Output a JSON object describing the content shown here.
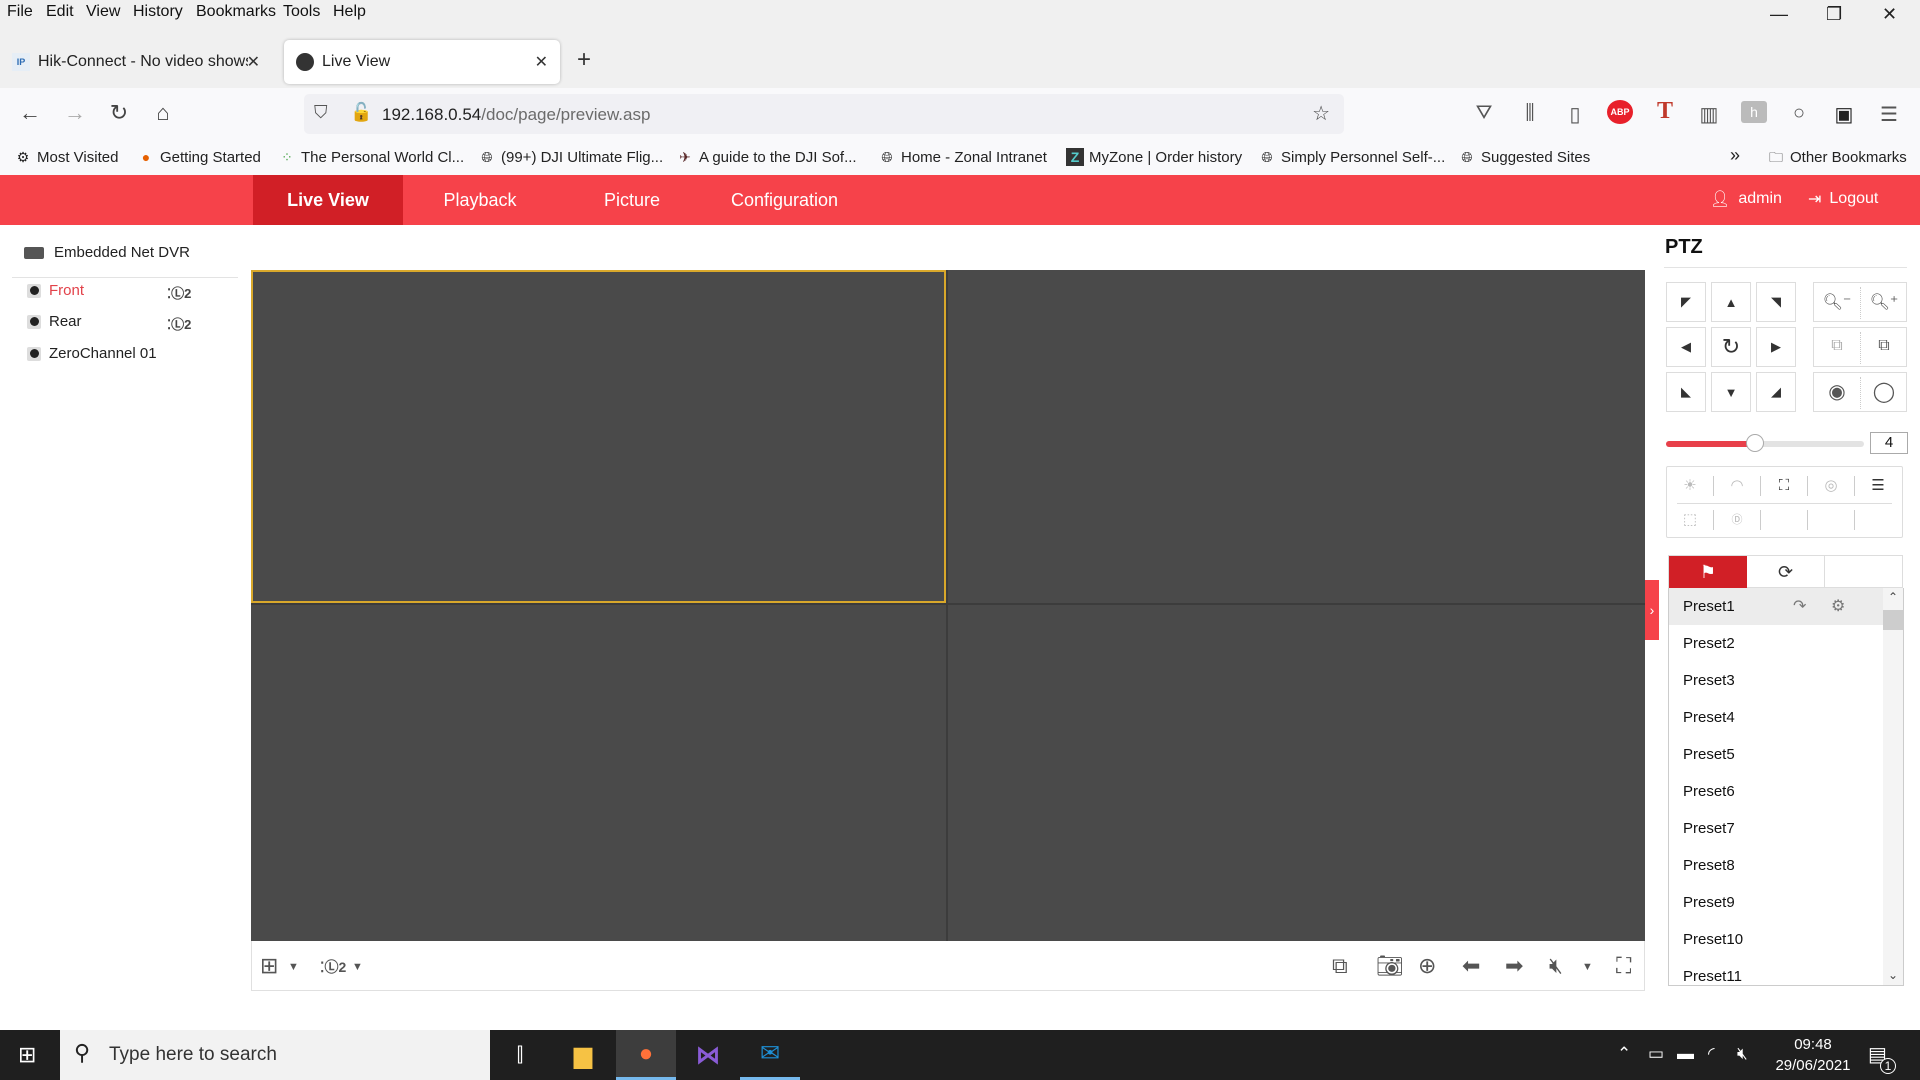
{
  "browser": {
    "menu": [
      "File",
      "Edit",
      "View",
      "History",
      "Bookmarks",
      "Tools",
      "Help"
    ],
    "window_controls": {
      "minimize_icon": "minimize-icon",
      "restore_icon": "restore-icon",
      "close_icon": "close-icon"
    },
    "tabs": [
      {
        "title": "Hik-Connect - No video shows i",
        "favicon": "use-ip-icon",
        "active": false
      },
      {
        "title": "Live View",
        "favicon": "camera-icon",
        "active": true
      }
    ],
    "new_tab": "+",
    "url": {
      "host": "192.168.0.54",
      "path": "/doc/page/preview.asp"
    },
    "toolbar_icons": [
      "pocket-icon",
      "library-icon",
      "sidebar-icon",
      "adblock-plus-icon",
      "t-extension-icon",
      "grid-extension-icon",
      "honey-extension-icon",
      "circle-extension-icon",
      "download-extension-icon",
      "menu-icon"
    ],
    "bookmarks": [
      {
        "label": "Most Visited",
        "icon": "gear-icon"
      },
      {
        "label": "Getting Started",
        "icon": "firefox-icon"
      },
      {
        "label": "The Personal World Cl...",
        "icon": "dots-icon"
      },
      {
        "label": "(99+) DJI Ultimate Flig...",
        "icon": "globe-icon"
      },
      {
        "label": "A guide to the DJI Sof...",
        "icon": "bird-icon"
      },
      {
        "label": "Home - Zonal Intranet",
        "icon": "globe-icon"
      },
      {
        "label": "MyZone | Order history",
        "icon": "z-icon"
      },
      {
        "label": "Simply Personnel Self-...",
        "icon": "globe-icon"
      },
      {
        "label": "Suggested Sites",
        "icon": "globe-icon"
      }
    ],
    "bookmarks_overflow": "»",
    "other_bookmarks": "Other Bookmarks"
  },
  "app": {
    "nav": [
      {
        "label": "Live View",
        "active": true
      },
      {
        "label": "Playback",
        "active": false
      },
      {
        "label": "Picture",
        "active": false
      },
      {
        "label": "Configuration",
        "active": false
      }
    ],
    "user": "admin",
    "logout": "Logout",
    "accent": "#f6424a",
    "accent_dark": "#d11f26"
  },
  "tree": {
    "root": "Embedded Net DVR",
    "channels": [
      {
        "name": "Front",
        "selected": true,
        "stream_icon": true
      },
      {
        "name": "Rear",
        "selected": false,
        "stream_icon": true
      },
      {
        "name": "ZeroChannel 01",
        "selected": false,
        "stream_icon": false
      }
    ]
  },
  "video": {
    "layout": "2x2",
    "selected_cell": 1,
    "toolbar_left": [
      "window-layout-icon",
      "stream-type-icon"
    ],
    "toolbar_right": [
      "stop-all-icon",
      "capture-icon",
      "digital-zoom-icon",
      "previous-page-icon",
      "next-page-icon",
      "audio-muted-icon",
      "fullscreen-icon"
    ]
  },
  "ptz": {
    "title": "PTZ",
    "speed": "4",
    "speed_fraction": 0.45,
    "direction_buttons": [
      "up-left",
      "up",
      "up-right",
      "left",
      "auto-rotate",
      "right",
      "down-left",
      "down",
      "down-right"
    ],
    "groups": [
      [
        "zoom-out-icon",
        "zoom-in-icon"
      ],
      [
        "focus-near-icon",
        "focus-far-icon"
      ],
      [
        "iris-open-icon",
        "iris-close-icon"
      ]
    ],
    "functions_row1": [
      "light-icon",
      "wiper-icon",
      "one-touch-focus-icon",
      "lens-init-icon",
      "menu-icon"
    ],
    "functions_row2": [
      "manual-tracking-icon",
      "3d-positioning-icon"
    ],
    "tabs": [
      "preset-icon",
      "patrol-icon",
      ""
    ],
    "presets": [
      "Preset1",
      "Preset2",
      "Preset3",
      "Preset4",
      "Preset5",
      "Preset6",
      "Preset7",
      "Preset8",
      "Preset9",
      "Preset10",
      "Preset11"
    ],
    "selected_preset": 0
  },
  "taskbar": {
    "search_placeholder": "Type here to search",
    "apps": [
      "task-view-icon",
      "file-explorer-icon",
      "firefox-icon",
      "visual-studio-icon",
      "mail-icon"
    ],
    "time": "09:48",
    "date": "29/06/2021",
    "notifications": "1"
  }
}
